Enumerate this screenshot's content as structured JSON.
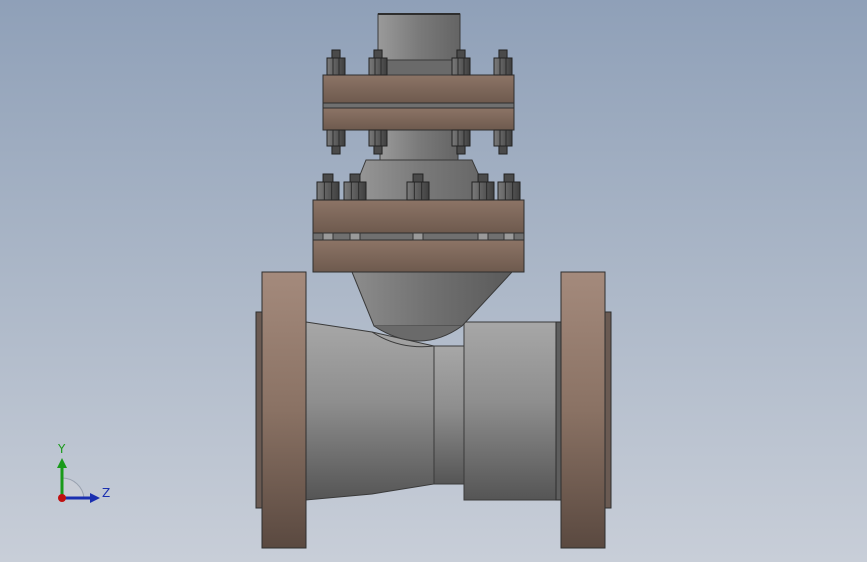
{
  "viewport": {
    "colors": {
      "background_top": "#8fa0b8",
      "background_bottom": "#c8ced8",
      "steel": "#8a8a8a",
      "flange": "#7a6558",
      "bolt": "#555555"
    }
  },
  "triad": {
    "y_label": "Y",
    "z_label": "Z",
    "colors": {
      "y": "#1a9a1a",
      "z": "#1a2fb0",
      "origin": "#c01010"
    }
  }
}
